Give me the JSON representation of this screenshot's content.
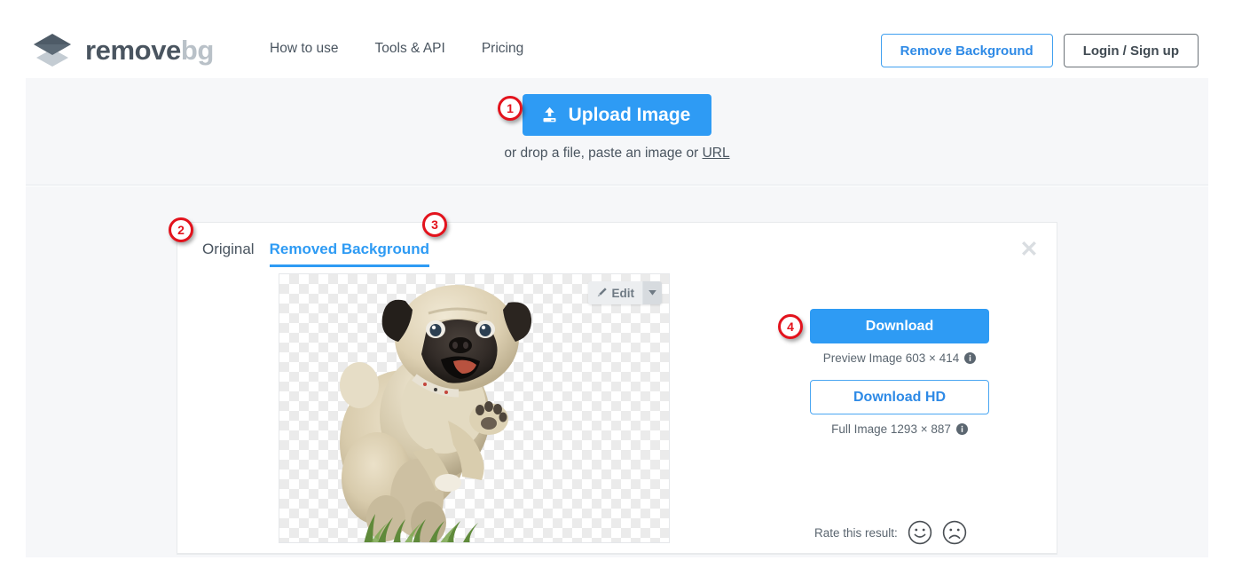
{
  "header": {
    "logo": {
      "icon": "layers-logo-icon",
      "text_primary": "remove",
      "text_secondary": "bg"
    },
    "nav": [
      {
        "label": "How to use"
      },
      {
        "label": "Tools & API"
      },
      {
        "label": "Pricing"
      }
    ],
    "remove_background_label": "Remove Background",
    "login_signup_label": "Login / Sign up"
  },
  "upload": {
    "button_label": "Upload Image",
    "button_icon": "upload-icon",
    "hint_prefix": "or drop a file, paste an image or ",
    "hint_link": "URL"
  },
  "card": {
    "tabs": [
      {
        "label": "Original",
        "active": false
      },
      {
        "label": "Removed Background",
        "active": true
      }
    ],
    "close_icon": "close-icon",
    "edit": {
      "label": "Edit",
      "icon": "brush-icon",
      "caret_icon": "chevron-down-icon"
    },
    "image_alt": "pug-dog-transparent-background"
  },
  "actions": {
    "download_label": "Download",
    "preview_meta": "Preview Image 603 × 414",
    "download_hd_label": "Download HD",
    "full_meta": "Full Image 1293 × 887",
    "info_icon": "info-icon",
    "rate_label": "Rate this result:",
    "rate_positive_icon": "smiley-face-icon",
    "rate_negative_icon": "frowning-face-icon"
  },
  "step_badges": [
    {
      "number": "1"
    },
    {
      "number": "2"
    },
    {
      "number": "3"
    },
    {
      "number": "4"
    }
  ],
  "colors": {
    "brand_blue": "#2e9bf4",
    "badge_red": "#e3131d",
    "text_dark": "#4a5560",
    "page_gray": "#f6f7f9"
  }
}
